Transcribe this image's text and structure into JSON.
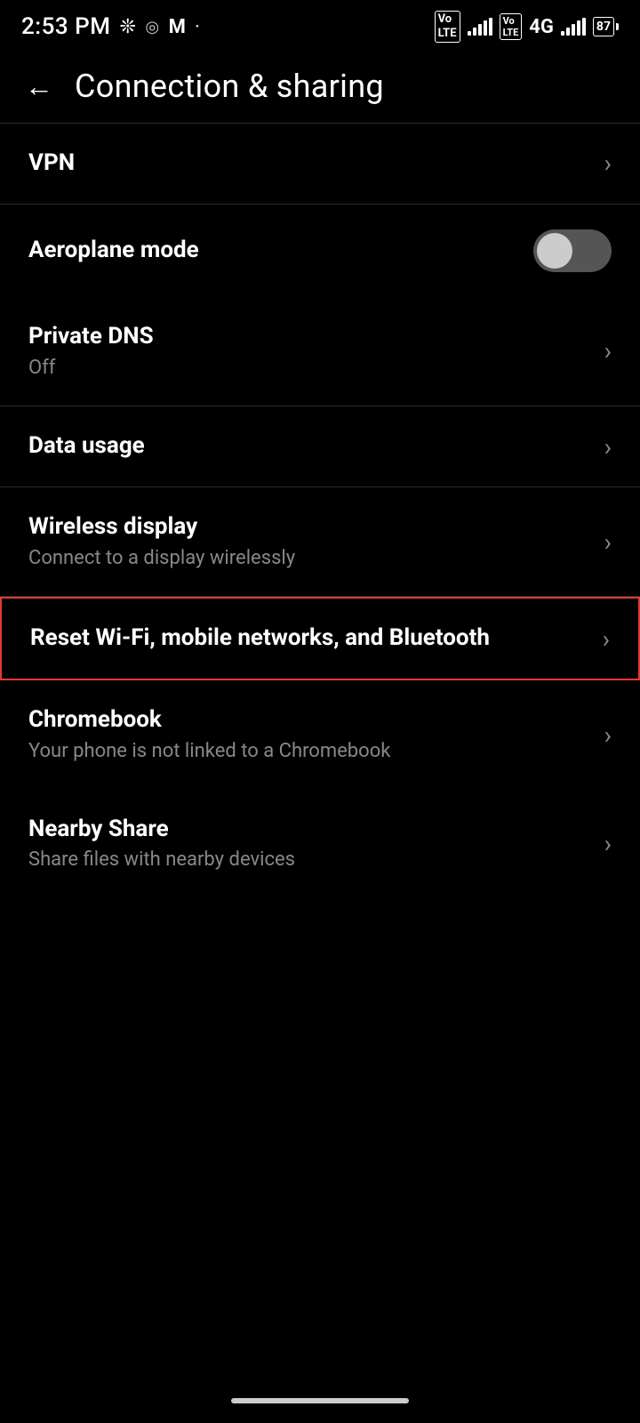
{
  "statusBar": {
    "time": "2:53 PM",
    "battery": "87"
  },
  "header": {
    "backLabel": "←",
    "title": "Connection & sharing"
  },
  "items": [
    {
      "id": "vpn",
      "title": "VPN",
      "subtitle": null,
      "type": "chevron",
      "highlighted": false
    },
    {
      "id": "aeroplane-mode",
      "title": "Aeroplane mode",
      "subtitle": null,
      "type": "toggle",
      "toggleState": "off",
      "highlighted": false
    },
    {
      "id": "private-dns",
      "title": "Private DNS",
      "subtitle": "Off",
      "type": "chevron",
      "highlighted": false
    },
    {
      "id": "data-usage",
      "title": "Data usage",
      "subtitle": null,
      "type": "chevron",
      "highlighted": false
    },
    {
      "id": "wireless-display",
      "title": "Wireless display",
      "subtitle": "Connect to a display wirelessly",
      "type": "chevron",
      "highlighted": false
    },
    {
      "id": "reset-wifi",
      "title": "Reset Wi-Fi, mobile networks, and Bluetooth",
      "subtitle": null,
      "type": "chevron",
      "highlighted": true
    },
    {
      "id": "chromebook",
      "title": "Chromebook",
      "subtitle": "Your phone is not linked to a Chromebook",
      "type": "chevron",
      "highlighted": false
    },
    {
      "id": "nearby-share",
      "title": "Nearby Share",
      "subtitle": "Share files with nearby devices",
      "type": "chevron",
      "highlighted": false
    }
  ],
  "chevronSymbol": "›",
  "dividerGroups": [
    0,
    2,
    3,
    4,
    5
  ]
}
